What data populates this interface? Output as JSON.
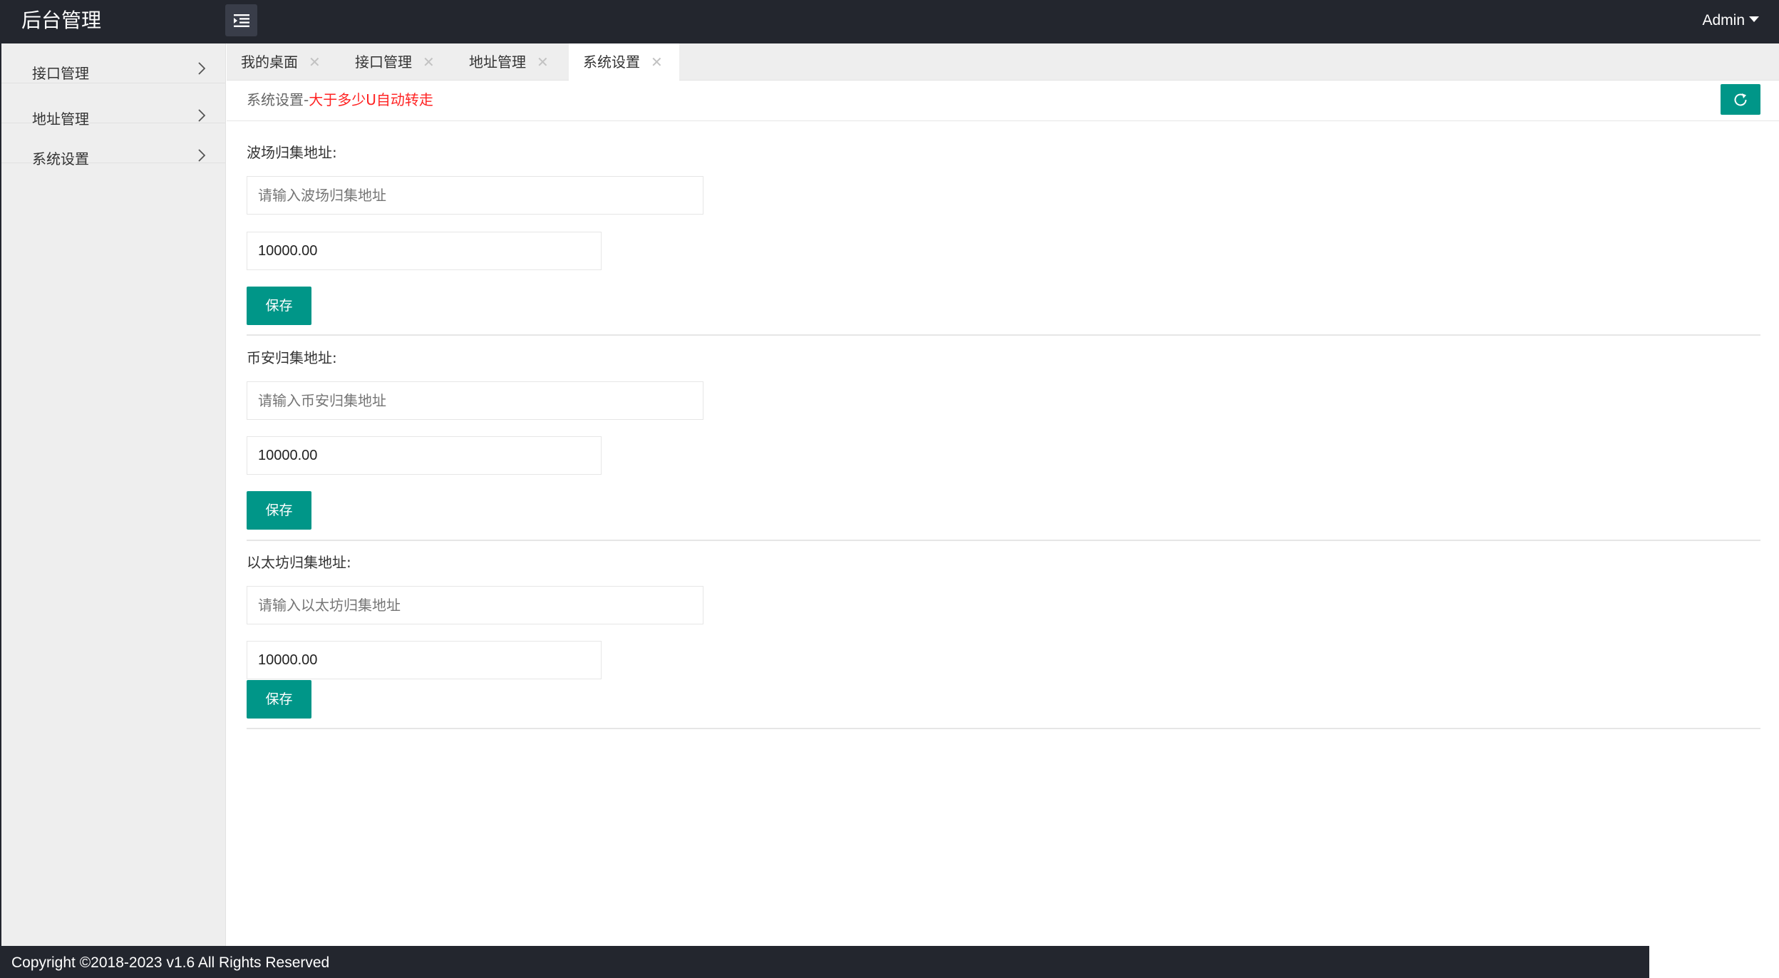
{
  "header": {
    "title": "后台管理",
    "user": "Admin"
  },
  "sidebar": {
    "items": [
      {
        "label": "接口管理"
      },
      {
        "label": "地址管理"
      },
      {
        "label": "系统设置"
      }
    ]
  },
  "tabs": [
    {
      "label": "我的桌面",
      "active": false
    },
    {
      "label": "接口管理",
      "active": false
    },
    {
      "label": "地址管理",
      "active": false
    },
    {
      "label": "系统设置",
      "active": true
    }
  ],
  "panel": {
    "title_prefix": "系统设置-",
    "title_highlight": "大于多少U自动转走"
  },
  "sections": [
    {
      "label": "波场归集地址:",
      "address_placeholder": "请输入波场归集地址",
      "address_value": "",
      "amount_value": "10000.00",
      "save_label": "保存"
    },
    {
      "label": "币安归集地址:",
      "address_placeholder": "请输入币安归集地址",
      "address_value": "",
      "amount_value": "10000.00",
      "save_label": "保存"
    },
    {
      "label": "以太坊归集地址:",
      "address_placeholder": "请输入以太坊归集地址",
      "address_value": "",
      "amount_value": "10000.00",
      "save_label": "保存"
    }
  ],
  "footer": {
    "text": "Copyright ©2018-2023 v1.6 All Rights Reserved"
  },
  "colors": {
    "header_bg": "#23262e",
    "accent": "#009688",
    "highlight": "#ff2222"
  }
}
